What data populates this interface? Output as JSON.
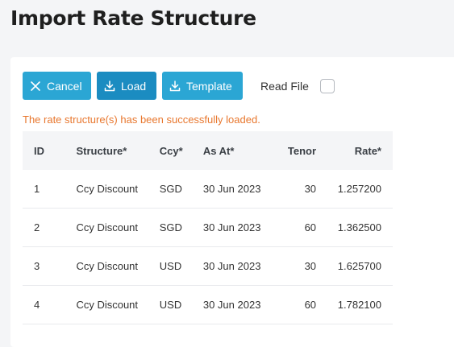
{
  "page": {
    "title": "Import Rate Structure"
  },
  "toolbar": {
    "cancel_label": "Cancel",
    "load_label": "Load",
    "template_label": "Template",
    "read_file_label": "Read File",
    "read_file_checked": false
  },
  "message": "The rate structure(s) has been successfully loaded.",
  "table": {
    "headers": {
      "id": "ID",
      "structure": "Structure*",
      "ccy": "Ccy*",
      "as_at": "As At*",
      "tenor": "Tenor",
      "rate": "Rate*"
    },
    "rows": [
      {
        "id": "1",
        "structure": "Ccy Discount",
        "ccy": "SGD",
        "as_at": "30 Jun 2023",
        "tenor": "30",
        "rate": "1.257200"
      },
      {
        "id": "2",
        "structure": "Ccy Discount",
        "ccy": "SGD",
        "as_at": "30 Jun 2023",
        "tenor": "60",
        "rate": "1.362500"
      },
      {
        "id": "3",
        "structure": "Ccy Discount",
        "ccy": "USD",
        "as_at": "30 Jun 2023",
        "tenor": "30",
        "rate": "1.625700"
      },
      {
        "id": "4",
        "structure": "Ccy Discount",
        "ccy": "USD",
        "as_at": "30 Jun 2023",
        "tenor": "60",
        "rate": "1.782100"
      }
    ]
  },
  "colors": {
    "primary_button": "#2ba6d4",
    "active_button": "#1b8cc1",
    "success_message": "#e8772e",
    "background": "#f4f5f7"
  },
  "icons": {
    "cancel": "close-icon",
    "load": "download-icon",
    "template": "download-icon"
  }
}
